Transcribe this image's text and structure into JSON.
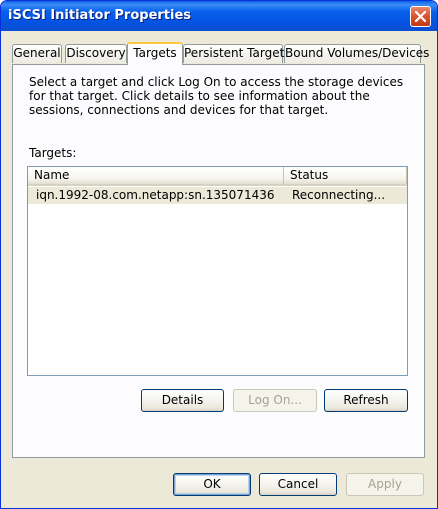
{
  "window": {
    "title": "iSCSI Initiator Properties",
    "close_icon": "close-icon"
  },
  "tabs": [
    {
      "label": "General",
      "active": false
    },
    {
      "label": "Discovery",
      "active": false
    },
    {
      "label": "Targets",
      "active": true
    },
    {
      "label": "Persistent Targets",
      "active": false
    },
    {
      "label": "Bound Volumes/Devices",
      "active": false
    }
  ],
  "targets_page": {
    "instructions": "Select a target and click Log On to access the storage devices for that target. Click details to see information about the sessions, connections and devices for that target.",
    "targets_label": "Targets:",
    "columns": {
      "name": "Name",
      "status": "Status"
    },
    "rows": [
      {
        "name": "iqn.1992-08.com.netapp:sn.135071436",
        "status": "Reconnecting..."
      }
    ],
    "buttons": {
      "details": "Details",
      "log_on": "Log On...",
      "refresh": "Refresh"
    }
  },
  "dialog_buttons": {
    "ok": "OK",
    "cancel": "Cancel",
    "apply": "Apply"
  }
}
